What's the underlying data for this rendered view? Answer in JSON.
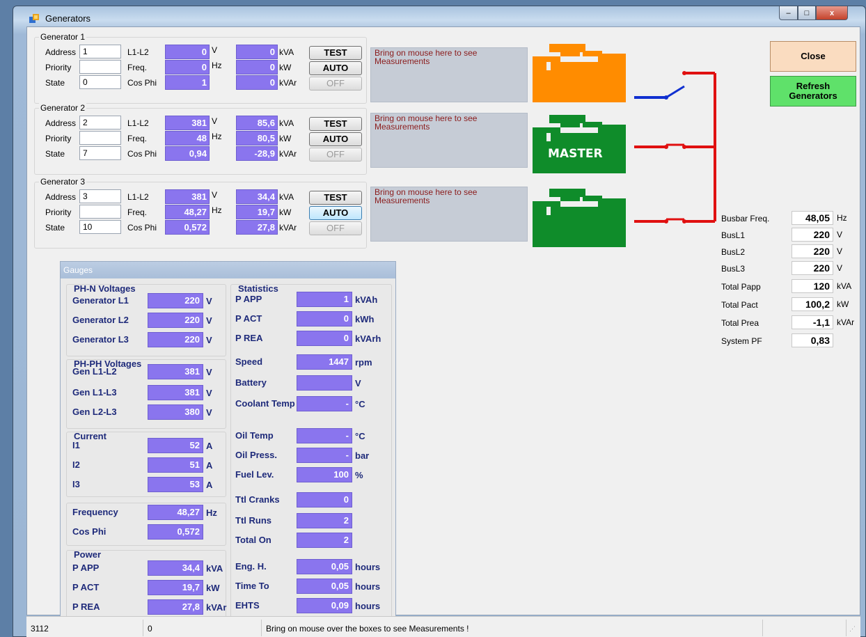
{
  "window": {
    "title": "Generators",
    "close_glyph": "x",
    "min_glyph": "–",
    "max_glyph": "□"
  },
  "labels": {
    "address": "Address",
    "priority": "Priority",
    "state": "State",
    "l1l2": "L1-L2",
    "freq": "Freq.",
    "cosphi": "Cos Phi",
    "u_v": "V",
    "u_hz": "Hz",
    "u_kva": "kVA",
    "u_kw": "kW",
    "u_kvar": "kVAr"
  },
  "generators": [
    {
      "title": "Generator 1",
      "address": "1",
      "priority": "",
      "state": "0",
      "voltage": "0",
      "freq": "0",
      "cosphi": "1",
      "kva": "0",
      "kw": "0",
      "kvar": "0",
      "btn_test": "TEST",
      "btn_auto": "AUTO",
      "btn_off": "OFF",
      "measure_hint": "Bring on mouse here to see Measurements",
      "color": "#ff8c00",
      "master_label": "",
      "breaker": "open"
    },
    {
      "title": "Generator 2",
      "address": "2",
      "priority": "",
      "state": "7",
      "voltage": "381",
      "freq": "48",
      "cosphi": "0,94",
      "kva": "85,6",
      "kw": "80,5",
      "kvar": "-28,9",
      "btn_test": "TEST",
      "btn_auto": "AUTO",
      "btn_off": "OFF",
      "measure_hint": "Bring on mouse here to see Measurements",
      "color": "#0f8c2a",
      "master_label": "MASTER",
      "breaker": "closed"
    },
    {
      "title": "Generator 3",
      "address": "3",
      "priority": "",
      "state": "10",
      "voltage": "381",
      "freq": "48,27",
      "cosphi": "0,572",
      "kva": "34,4",
      "kw": "19,7",
      "kvar": "27,8",
      "btn_test": "TEST",
      "btn_auto": "AUTO",
      "btn_off": "OFF",
      "measure_hint": "Bring on mouse here to see Measurements",
      "color": "#0f8c2a",
      "master_label": "",
      "breaker": "closed"
    }
  ],
  "buttons": {
    "close": "Close",
    "refresh_line1": "Refresh",
    "refresh_line2": "Generators"
  },
  "bus": [
    {
      "label": "Busbar Freq.",
      "value": "48,05",
      "unit": "Hz"
    },
    {
      "label": "BusL1",
      "value": "220",
      "unit": "V"
    },
    {
      "label": "BusL2",
      "value": "220",
      "unit": "V"
    },
    {
      "label": "BusL3",
      "value": "220",
      "unit": "V"
    },
    {
      "label": "Total Papp",
      "value": "120",
      "unit": "kVA"
    },
    {
      "label": "Total Pact",
      "value": "100,2",
      "unit": "kW"
    },
    {
      "label": "Total Prea",
      "value": "-1,1",
      "unit": "kVAr"
    },
    {
      "label": "System PF",
      "value": "0,83",
      "unit": ""
    }
  ],
  "gauges": {
    "title": "Gauges",
    "phn": {
      "title": "PH-N Voltages",
      "rows": [
        {
          "label": "Generator L1",
          "value": "220",
          "unit": "V"
        },
        {
          "label": "Generator L2",
          "value": "220",
          "unit": "V"
        },
        {
          "label": "Generator L3",
          "value": "220",
          "unit": "V"
        }
      ]
    },
    "phph": {
      "title": "PH-PH Voltages",
      "rows": [
        {
          "label": "Gen L1-L2",
          "value": "381",
          "unit": "V"
        },
        {
          "label": "Gen L1-L3",
          "value": "381",
          "unit": "V"
        },
        {
          "label": "Gen L2-L3",
          "value": "380",
          "unit": "V"
        }
      ]
    },
    "current": {
      "title": "Current",
      "rows": [
        {
          "label": "I1",
          "value": "52",
          "unit": "A"
        },
        {
          "label": "I2",
          "value": "51",
          "unit": "A"
        },
        {
          "label": "I3",
          "value": "53",
          "unit": "A"
        }
      ]
    },
    "freq": {
      "rows": [
        {
          "label": "Frequency",
          "value": "48,27",
          "unit": "Hz"
        },
        {
          "label": "Cos Phi",
          "value": "0,572",
          "unit": ""
        }
      ]
    },
    "power": {
      "title": "Power",
      "rows": [
        {
          "label": "P APP",
          "value": "34,4",
          "unit": "kVA"
        },
        {
          "label": "P ACT",
          "value": "19,7",
          "unit": "kW"
        },
        {
          "label": "P REA",
          "value": "27,8",
          "unit": "kVAr"
        }
      ]
    },
    "stats": {
      "title": "Statistics",
      "rows": [
        {
          "label": "P APP",
          "value": "1",
          "unit": "kVAh"
        },
        {
          "label": "P ACT",
          "value": "0",
          "unit": "kWh"
        },
        {
          "label": "P REA",
          "value": "0",
          "unit": "kVArh"
        },
        {
          "label": "Speed",
          "value": "1447",
          "unit": "rpm"
        },
        {
          "label": "Battery",
          "value": "",
          "unit": "V"
        },
        {
          "label": "Coolant Temp",
          "value": "-",
          "unit": "°C"
        },
        {
          "label": "Oil Temp",
          "value": "-",
          "unit": "°C"
        },
        {
          "label": "Oil Press.",
          "value": "-",
          "unit": "bar"
        },
        {
          "label": "Fuel Lev.",
          "value": "100",
          "unit": "%"
        },
        {
          "label": "Ttl Cranks",
          "value": "0",
          "unit": ""
        },
        {
          "label": "Ttl Runs",
          "value": "2",
          "unit": ""
        },
        {
          "label": "Total On",
          "value": "2",
          "unit": ""
        },
        {
          "label": "Eng. H.",
          "value": "0,05",
          "unit": "hours"
        },
        {
          "label": "Time To",
          "value": "0,05",
          "unit": "hours"
        },
        {
          "label": "EHTS",
          "value": "0,09",
          "unit": "hours"
        }
      ]
    }
  },
  "statusbar": {
    "cell1": "3112",
    "cell2": "0",
    "cell3": "Bring on mouse over the boxes to see Measurements !"
  }
}
